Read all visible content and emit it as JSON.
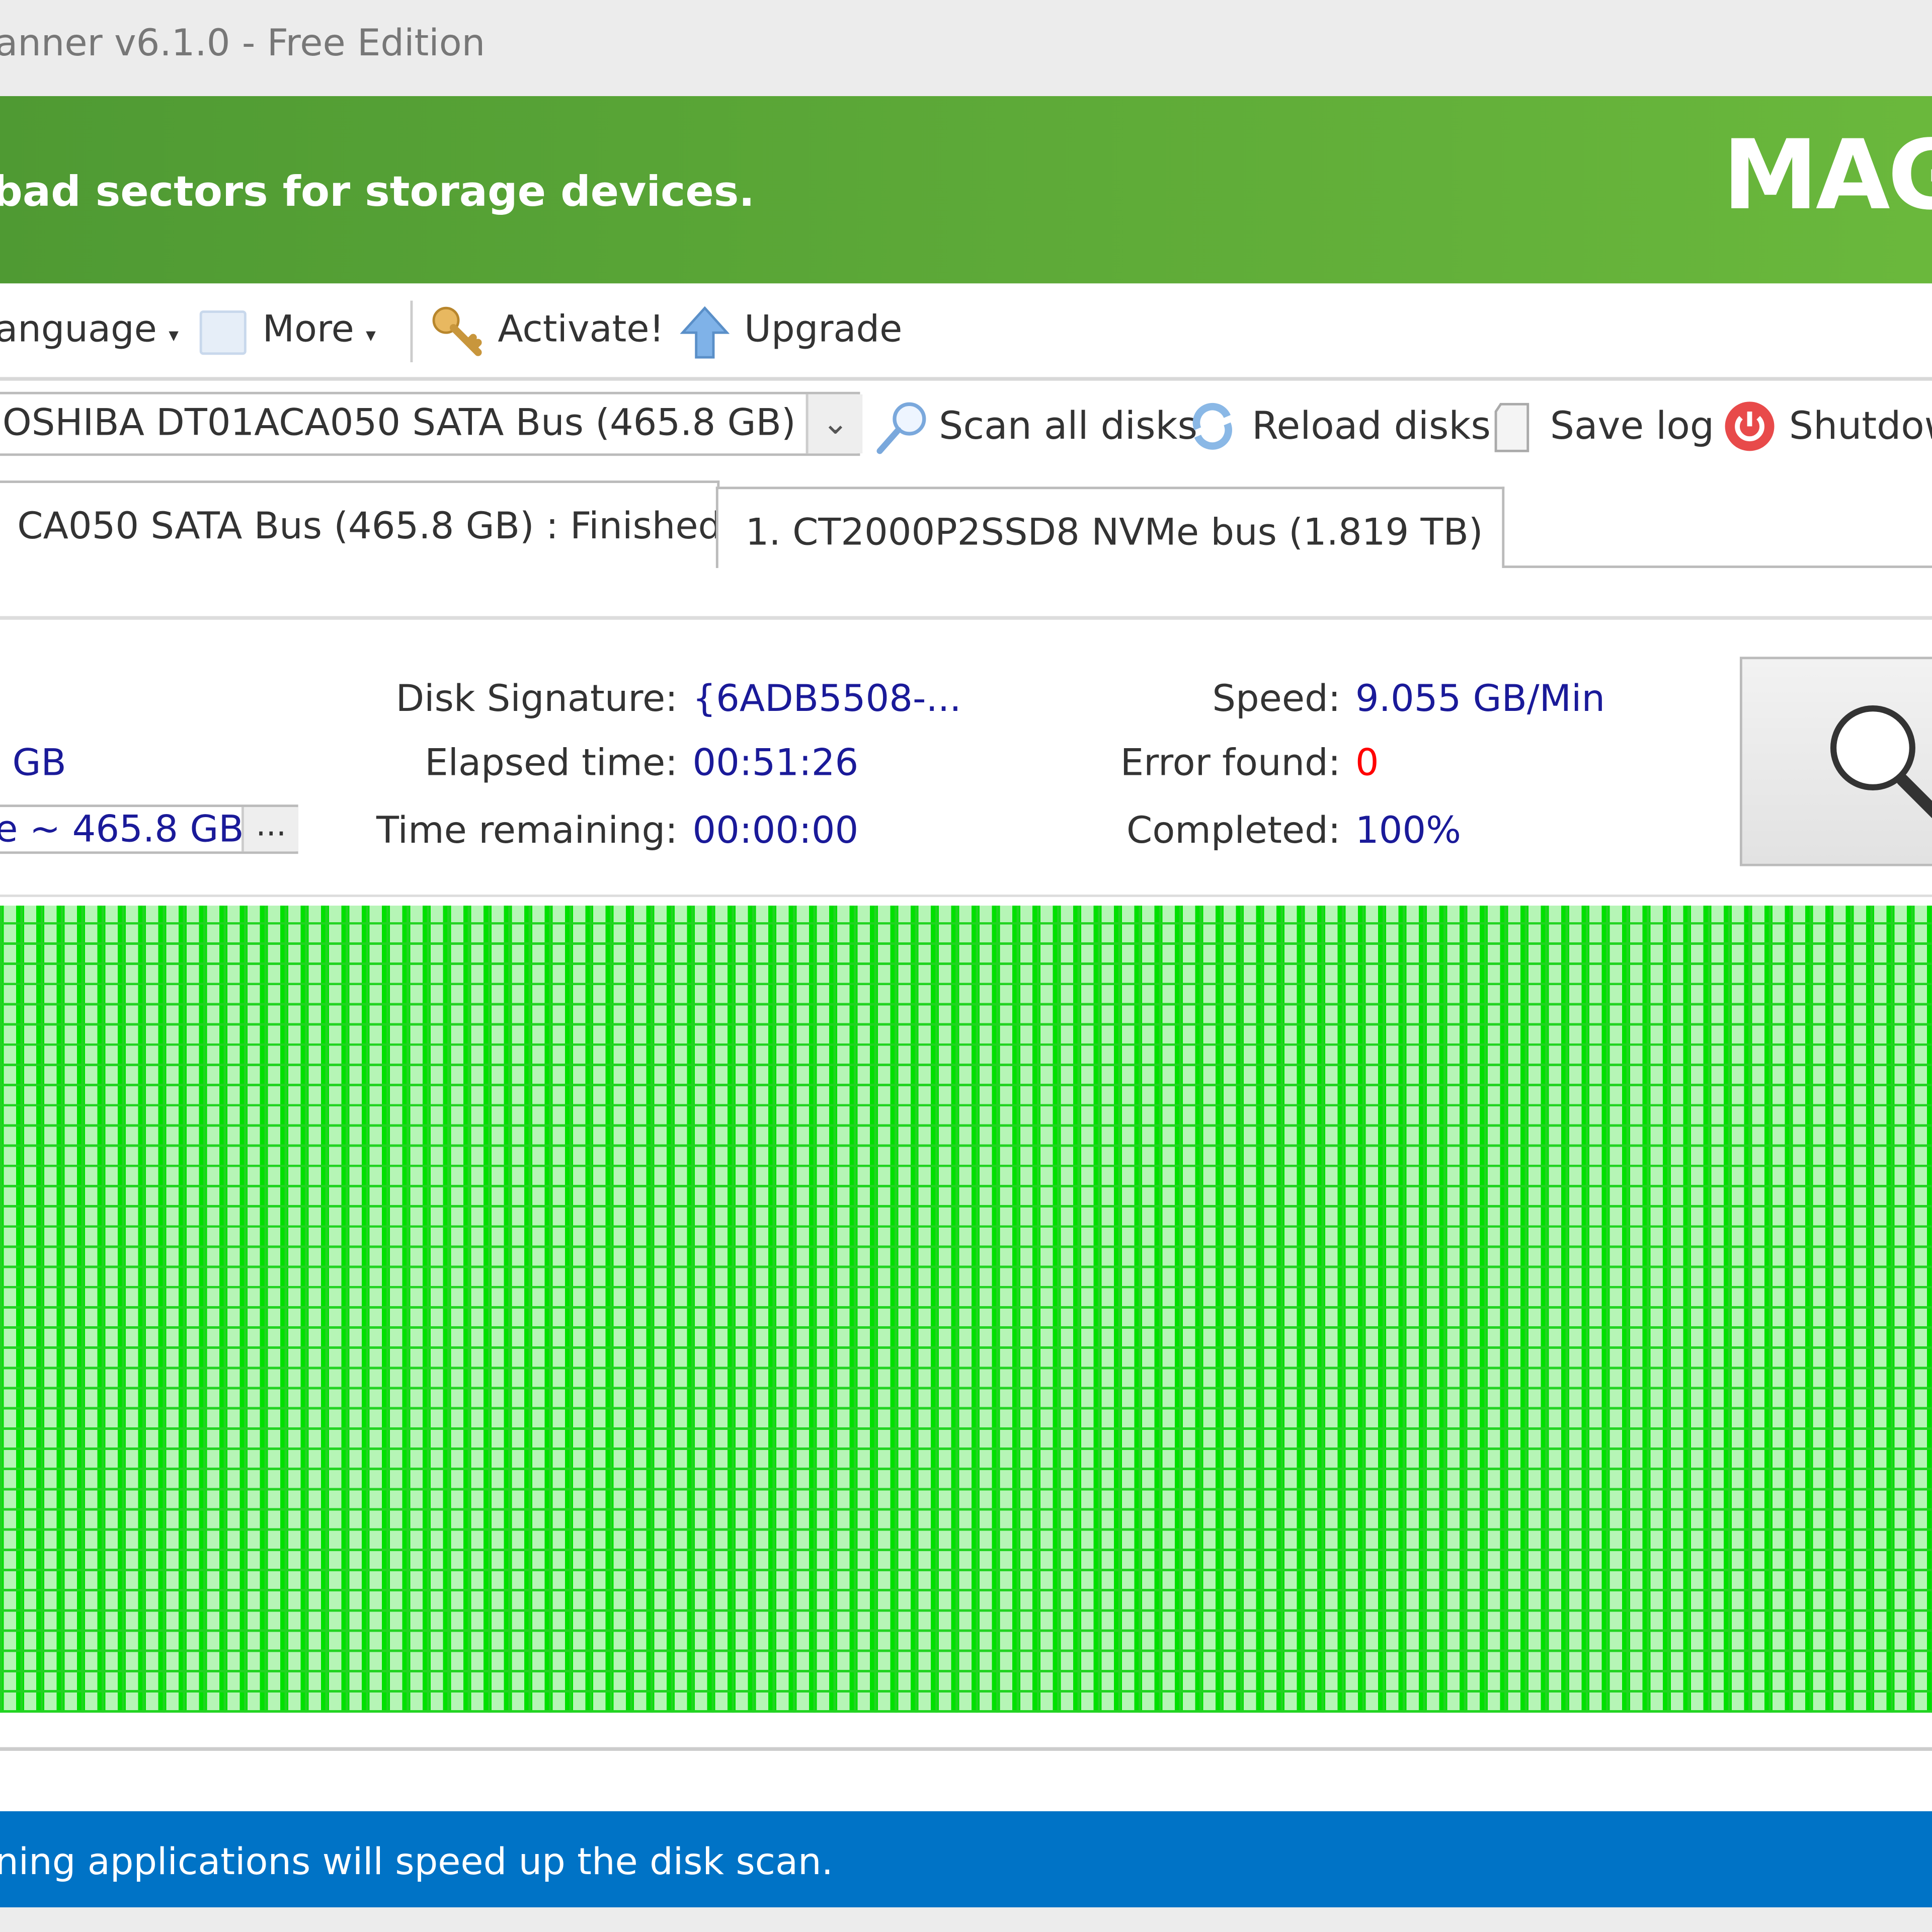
{
  "window": {
    "title": "anner v6.1.0 - Free Edition"
  },
  "banner": {
    "tagline": "bad sectors for storage devices.",
    "logo": "MAG",
    "color": "#5aa637"
  },
  "toolbar": {
    "language": "anguage",
    "more": "More",
    "activate": "Activate!",
    "upgrade": "Upgrade",
    "caret": "▾"
  },
  "actions": {
    "disk_selected": "OSHIBA DT01ACA050 SATA Bus (465.8 GB)",
    "dropdown_glyph": "⌄",
    "scan_all": "Scan all disks",
    "reload": "Reload disks",
    "save_log": "Save log",
    "shutdown": "Shutdow"
  },
  "tabs": [
    {
      "label": "CA050 SATA Bus (465.8 GB) : Finished",
      "active": true
    },
    {
      "label": "1. CT2000P2SSD8 NVMe bus (1.819 TB)",
      "active": false
    }
  ],
  "info": {
    "size_partial": "GB",
    "range_value": "e ~ 465.8 GB",
    "range_button": "...",
    "disk_signature_label": "Disk Signature:",
    "disk_signature": "{6ADB5508-...",
    "elapsed_label": "Elapsed time:",
    "elapsed": "00:51:26",
    "remaining_label": "Time remaining:",
    "remaining": "00:00:00",
    "speed_label": "Speed:",
    "speed": "9.055 GB/Min",
    "errors_label": "Error found:",
    "errors": "0",
    "completed_label": "Completed:",
    "completed": "100%",
    "progress_percent": 100
  },
  "sector_map": {
    "status": "all good",
    "color": "#00e000"
  },
  "status": {
    "message": "ning applications will speed up the disk scan.",
    "color": "#0073c6"
  }
}
